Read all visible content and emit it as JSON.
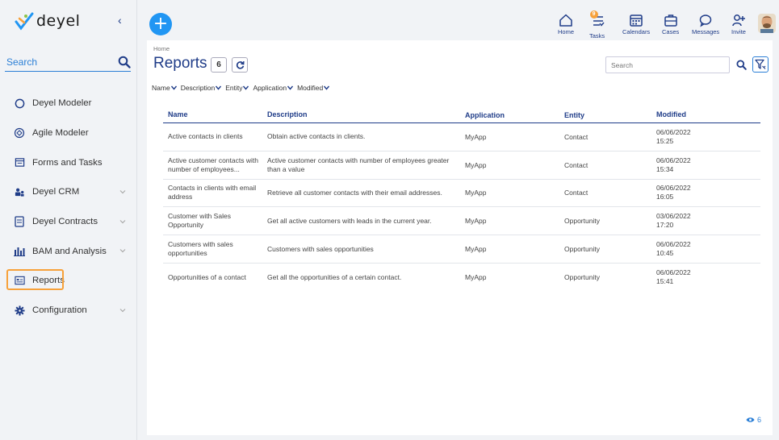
{
  "brand": {
    "name": "deyel",
    "accent": "#2196f3",
    "navy": "#1f3c88",
    "highlight": "#f7a13a"
  },
  "sidebar": {
    "search_label": "Search",
    "items": [
      {
        "label": "Deyel Modeler",
        "icon": "circle-icon",
        "expandable": false
      },
      {
        "label": "Agile Modeler",
        "icon": "agile-icon",
        "expandable": false
      },
      {
        "label": "Forms and Tasks",
        "icon": "forms-icon",
        "expandable": false
      },
      {
        "label": "Deyel CRM",
        "icon": "crm-icon",
        "expandable": true
      },
      {
        "label": "Deyel Contracts",
        "icon": "contracts-icon",
        "expandable": true
      },
      {
        "label": "BAM and Analysis",
        "icon": "chart-icon",
        "expandable": true
      },
      {
        "label": "Reports",
        "icon": "reports-icon",
        "expandable": false,
        "active": true
      },
      {
        "label": "Configuration",
        "icon": "gear-icon",
        "expandable": true
      }
    ]
  },
  "topbar": {
    "home": "Home",
    "tasks": "Tasks",
    "tasks_badge": "9",
    "calendars": "Calendars",
    "cases": "Cases",
    "messages": "Messages",
    "invite": "Invite"
  },
  "page": {
    "breadcrumb": "Home",
    "title": "Reports",
    "count": "6",
    "search_placeholder": "Search",
    "filters": [
      "Name",
      "Description",
      "Entity",
      "Application",
      "Modified"
    ],
    "footer_count": "6"
  },
  "table": {
    "headers": {
      "name": "Name",
      "description": "Description",
      "application": "Application",
      "entity": "Entity",
      "modified": "Modified"
    },
    "rows": [
      {
        "name": "Active contacts in clients",
        "description": "Obtain active contacts in clients.",
        "application": "MyApp",
        "entity": "Contact",
        "date": "06/06/2022",
        "time": "15:25"
      },
      {
        "name": "Active customer contacts with number of employees...",
        "description": "Active customer contacts with number of employees greater than a value",
        "application": "MyApp",
        "entity": "Contact",
        "date": "06/06/2022",
        "time": "15:34"
      },
      {
        "name": "Contacts in clients with email address",
        "description": "Retrieve all customer contacts with their email addresses.",
        "application": "MyApp",
        "entity": "Contact",
        "date": "06/06/2022",
        "time": "16:05"
      },
      {
        "name": "Customer with Sales Opportunity",
        "description": "Get all active customers with leads in the current year.",
        "application": "MyApp",
        "entity": "Opportunity",
        "date": "03/06/2022",
        "time": "17:20"
      },
      {
        "name": "Customers with sales opportunities",
        "description": "Customers with sales opportunities",
        "application": "MyApp",
        "entity": "Opportunity",
        "date": "06/06/2022",
        "time": "10:45"
      },
      {
        "name": "Opportunities of a contact",
        "description": "Get all the opportunities of a certain contact.",
        "application": "MyApp",
        "entity": "Opportunity",
        "date": "06/06/2022",
        "time": "15:41"
      }
    ]
  }
}
